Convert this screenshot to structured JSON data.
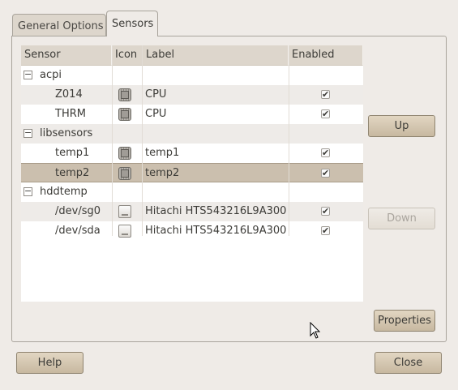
{
  "tabs": [
    {
      "label": "General Options",
      "active": false
    },
    {
      "label": "Sensors",
      "active": true
    }
  ],
  "tree": {
    "columns": [
      "Sensor",
      "Icon",
      "Label",
      "Enabled"
    ],
    "groups": [
      {
        "name": "acpi",
        "expander": "−",
        "children": [
          {
            "sensor": "Z014",
            "icon": "chip-icon",
            "label": "CPU",
            "enabled": true
          },
          {
            "sensor": "THRM",
            "icon": "chip-icon",
            "label": "CPU",
            "enabled": true
          }
        ]
      },
      {
        "name": "libsensors",
        "expander": "−",
        "children": [
          {
            "sensor": "temp1",
            "icon": "chip-icon",
            "label": "temp1",
            "enabled": true
          },
          {
            "sensor": "temp2",
            "icon": "chip-icon",
            "label": "temp2",
            "enabled": true,
            "selected": true
          }
        ]
      },
      {
        "name": "hddtemp",
        "expander": "−",
        "children": [
          {
            "sensor": "/dev/sg0",
            "icon": "disk-icon",
            "label": "Hitachi HTS543216L9A300",
            "enabled": true
          },
          {
            "sensor": "/dev/sda",
            "icon": "disk-icon",
            "label": "Hitachi HTS543216L9A300",
            "enabled": true
          }
        ]
      }
    ],
    "check_glyph": "✔"
  },
  "buttons": {
    "up": "Up",
    "down": "Down",
    "properties": "Properties",
    "help": "Help",
    "close": "Close"
  },
  "colors": {
    "window_bg": "#efebe7",
    "selection": "#cbbfae",
    "button": "#d6c9b3"
  }
}
